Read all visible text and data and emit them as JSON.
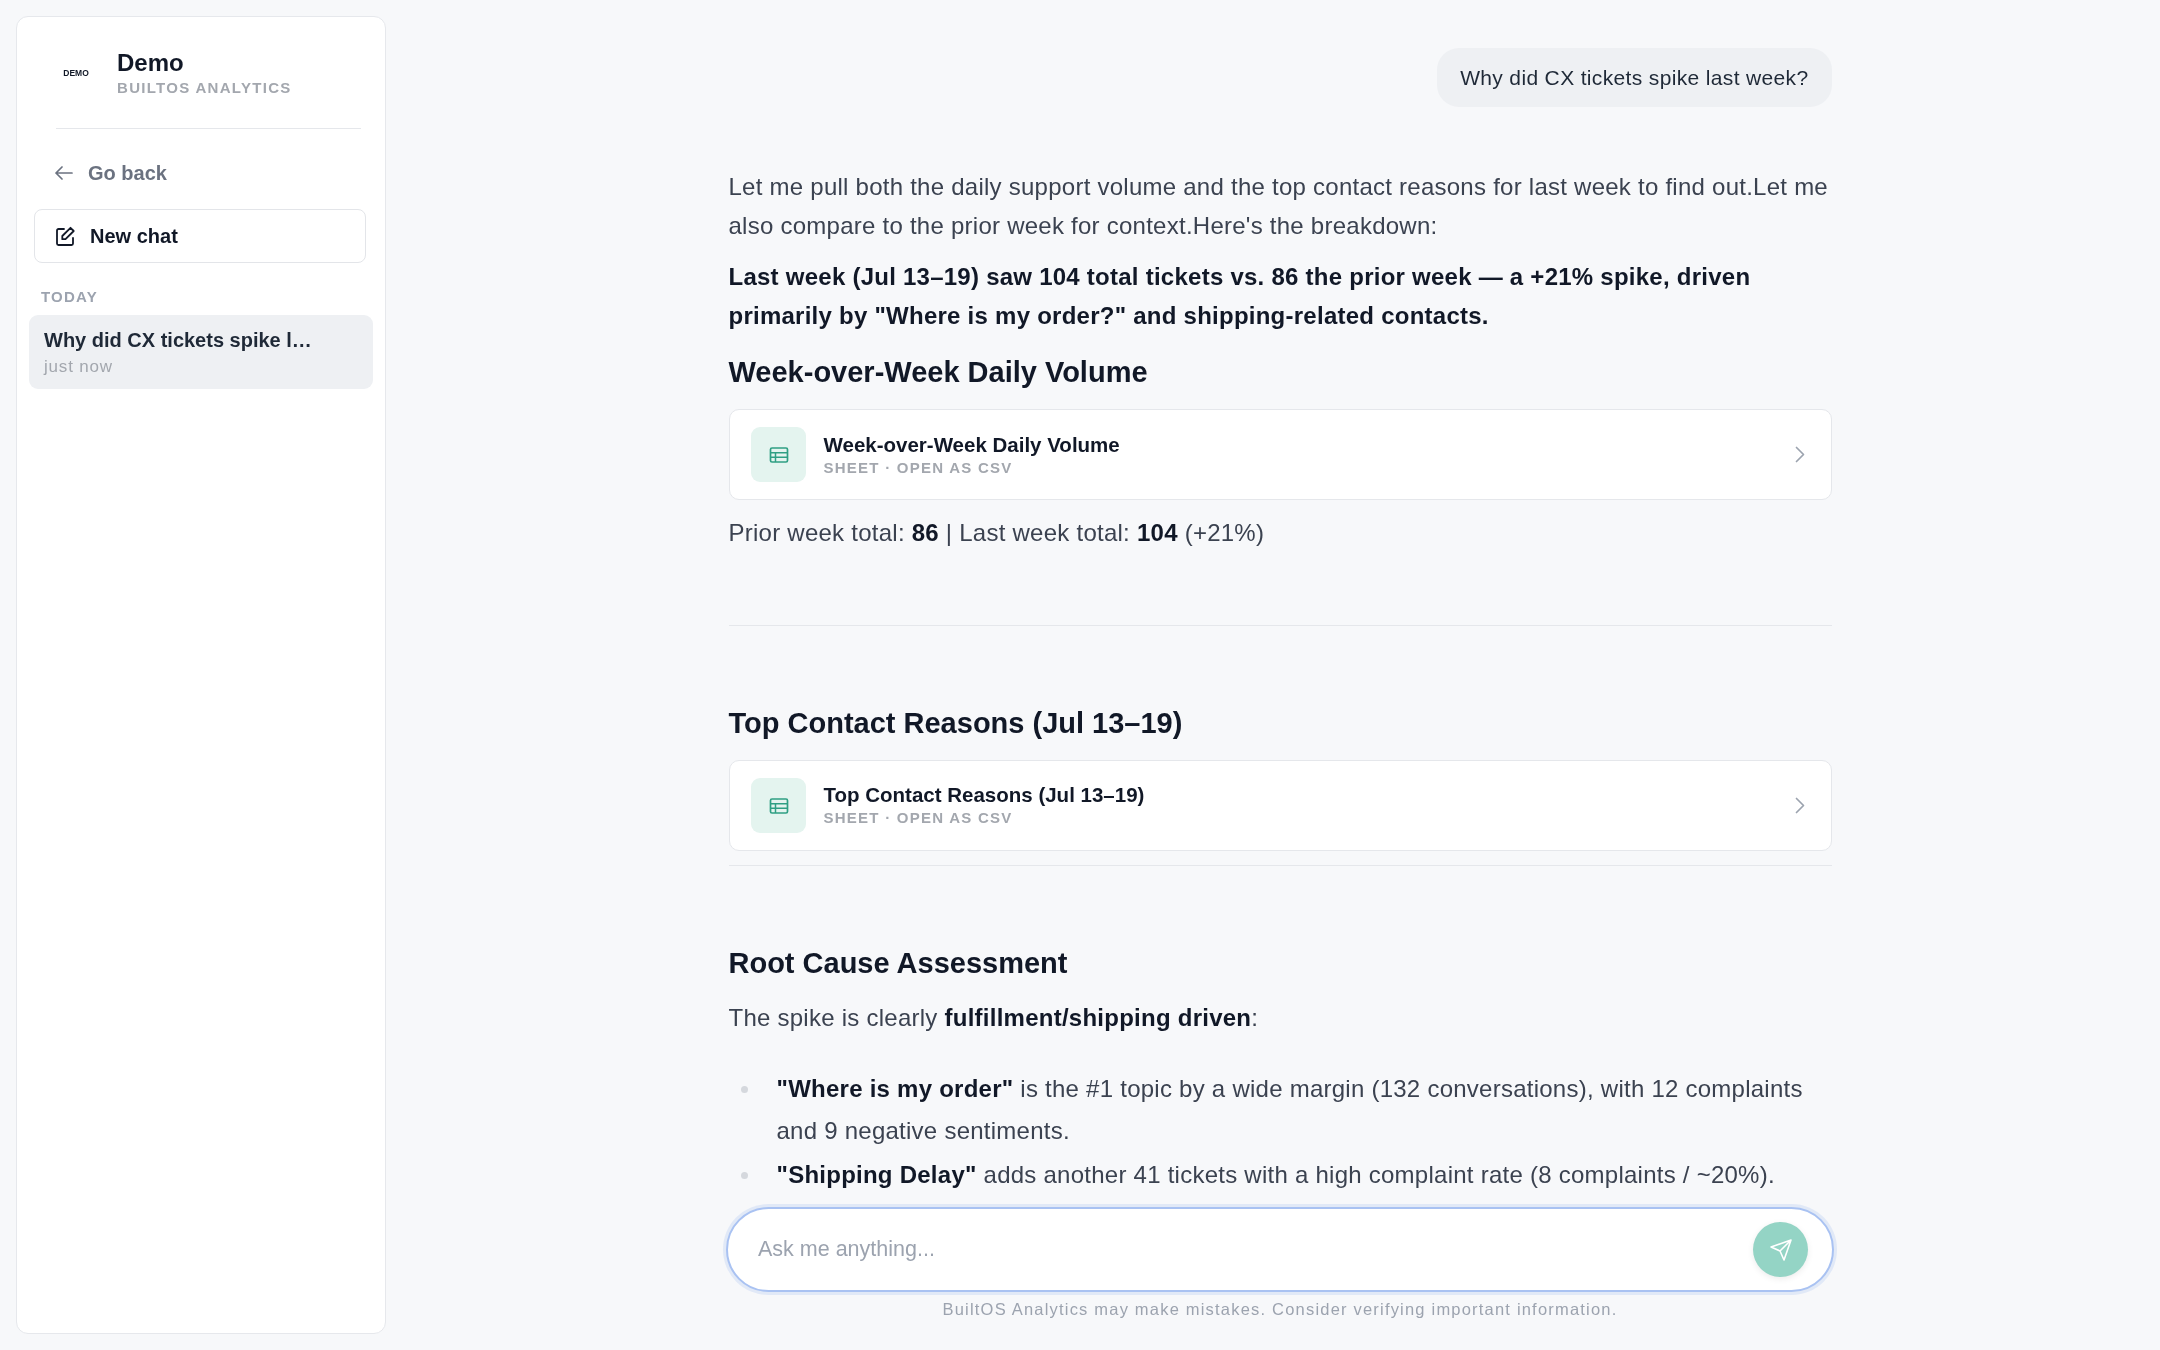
{
  "sidebar": {
    "logo_text": "DEMO",
    "title": "Demo",
    "subtitle": "BUILTOS ANALYTICS",
    "back_link": "Go back",
    "new_chat_button": "New chat",
    "history_groups": [
      {
        "label": "TODAY",
        "items": [
          {
            "title": "Why did CX tickets spike l…",
            "time": "just now",
            "selected": true
          }
        ]
      }
    ]
  },
  "chat": {
    "messages": [
      {
        "kind": "user",
        "text": "Why did CX tickets spike last week?"
      },
      {
        "kind": "assistant",
        "blocks": [
          {
            "kind": "text",
            "text": "Let me pull both the daily support volume and the top contact reasons for last week to find out.Let me also compare to the prior week for context.Here's the breakdown:"
          },
          {
            "kind": "bold_text",
            "text": "Last week (Jul 13–19) saw 104 total tickets vs. 86 the prior week — a +21% spike, driven primarily by \"Where is my order?\" and shipping-related contacts."
          },
          {
            "kind": "heading",
            "text": "Week-over-Week Daily Volume"
          },
          {
            "kind": "sheet",
            "title": "Week-over-Week Daily Volume",
            "subtitle": "SHEET · OPEN AS CSV"
          },
          {
            "kind": "text",
            "text": "Prior week total: **86** | Last week total: **104** (+21%)"
          },
          {
            "kind": "divider"
          },
          {
            "kind": "heading",
            "text": "Top Contact Reasons (Jul 13–19)"
          },
          {
            "kind": "sheet",
            "title": "Top Contact Reasons (Jul 13–19)",
            "subtitle": "SHEET · OPEN AS CSV"
          },
          {
            "kind": "divider"
          },
          {
            "kind": "heading",
            "text": "Root Cause Assessment"
          },
          {
            "kind": "text",
            "text": "The spike is clearly **fulfillment/shipping driven**:"
          },
          {
            "kind": "bullets",
            "items": [
              "**\"Where is my order\"** is the #1 topic by a wide margin (132 conversations), with 12 complaints and 9 negative sentiments.",
              "**\"Shipping Delay\"** adds another 41 tickets with a high complaint rate (8 complaints / ~20%)."
            ]
          }
        ]
      }
    ]
  },
  "composer": {
    "placeholder": "Ask me anything...",
    "send_button": {
      "disabled": true
    },
    "disclaimer": "BuiltOS Analytics may make mistakes. Consider verifying important information."
  }
}
